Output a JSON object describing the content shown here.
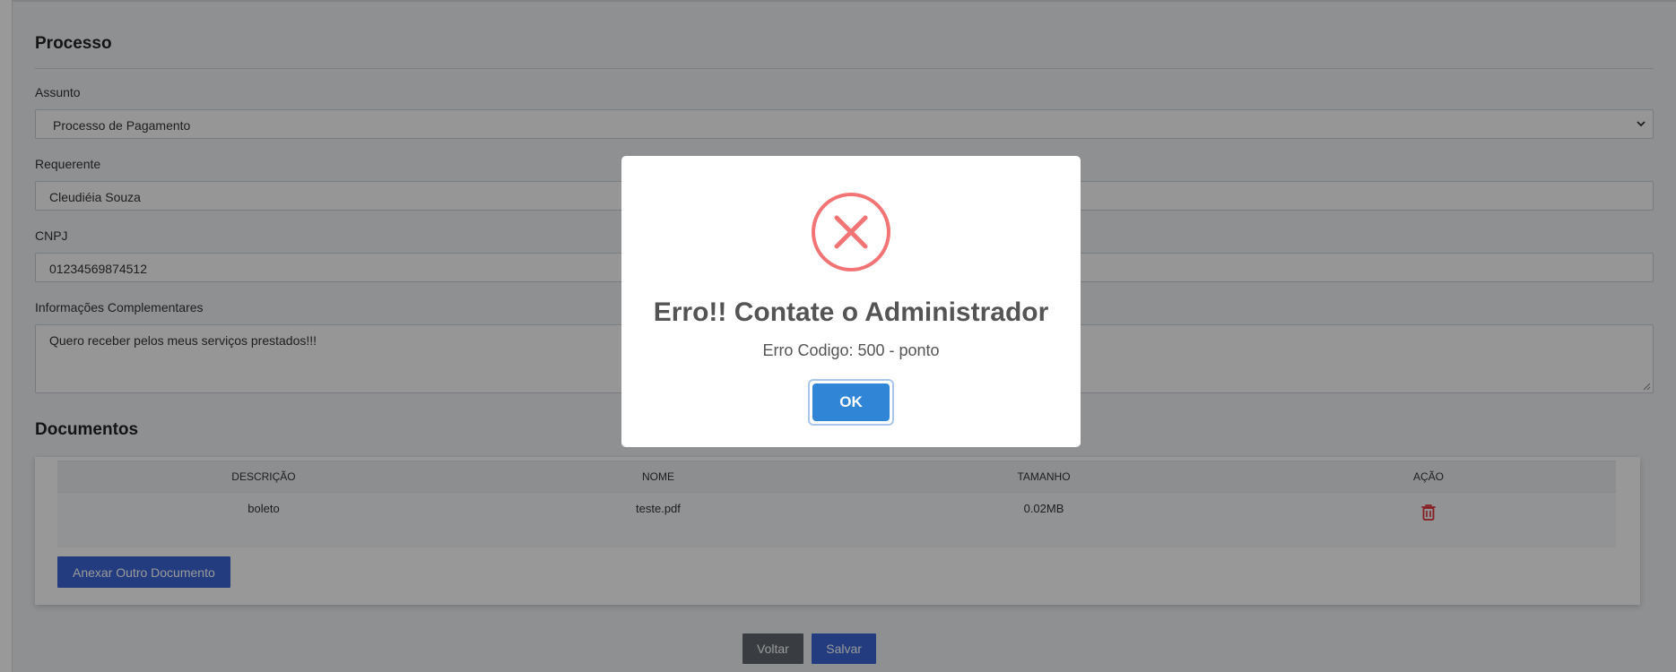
{
  "form": {
    "section_title": "Processo",
    "assunto": {
      "label": "Assunto",
      "value": "Processo de Pagamento"
    },
    "requerente": {
      "label": "Requerente",
      "value": "Cleudiéia Souza"
    },
    "cnpj": {
      "label": "CNPJ",
      "value": "01234569874512"
    },
    "info": {
      "label": "Informações Complementares",
      "value": "Quero receber pelos meus serviços prestados!!!"
    }
  },
  "documents": {
    "section_title": "Documentos",
    "columns": [
      "DESCRIÇÃO",
      "NOME",
      "TAMANHO",
      "AÇÃO"
    ],
    "rows": [
      {
        "descricao": "boleto",
        "nome": "teste.pdf",
        "tamanho": "0.02MB",
        "acao_icon": "trash-icon"
      }
    ],
    "attach_button": "Anexar Outro Documento"
  },
  "actions": {
    "back_label": "Voltar",
    "save_label": "Salvar"
  },
  "modal": {
    "icon": "error-x-icon",
    "title": "Erro!! Contate o Administrador",
    "text": "Erro Codigo: 500 - ponto",
    "ok_label": "OK"
  },
  "colors": {
    "primary": "#3b64d4",
    "secondary": "#5f656b",
    "modal_confirm": "#3085d6",
    "error_icon": "#f27474",
    "danger_icon": "#e0333a"
  }
}
